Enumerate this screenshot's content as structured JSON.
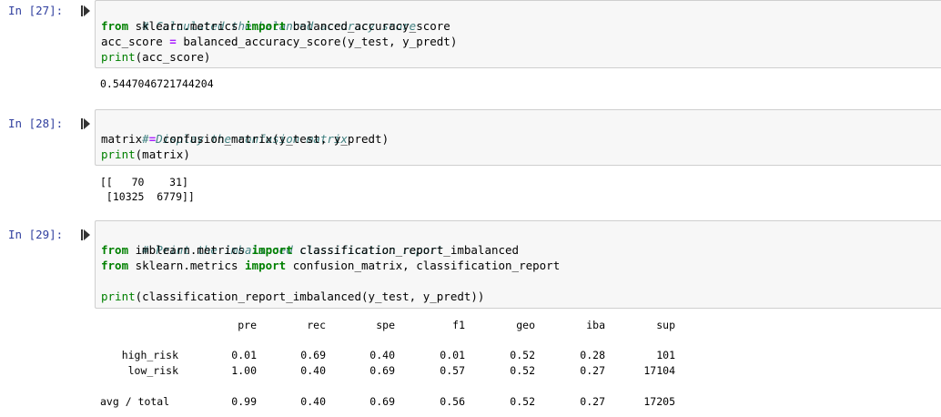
{
  "cells": [
    {
      "prompt": "In [27]:",
      "code": {
        "comment": "# Calculated the balanced accuracy score",
        "line2": {
          "kw1": "from",
          "mod": " sklearn.metrics ",
          "kw2": "import",
          "rest": " balanced_accuracy_score"
        },
        "line3": {
          "a": "acc_score ",
          "op": "=",
          "b": " balanced_accuracy_score(y_test, y_predt)"
        },
        "line4": {
          "fn": "print",
          "rest": "(acc_score)"
        }
      },
      "output": [
        "0.5447046721744204"
      ]
    },
    {
      "prompt": "In [28]:",
      "code": {
        "comment": "# Display the confusion matrix",
        "line2": {
          "a": "matrix ",
          "op": "=",
          "b": " confusion_matrix(y_test, y_predt)"
        },
        "line3": {
          "fn": "print",
          "rest": "(matrix)"
        }
      },
      "output": [
        "[[   70    31]",
        " [10325  6779]]"
      ]
    },
    {
      "prompt": "In [29]:",
      "code": {
        "comment": "# Print the imbalanced classification report",
        "line2": {
          "kw1": "from",
          "mod": " imblearn.metrics ",
          "kw2": "import",
          "rest": " classification_report_imbalanced"
        },
        "line3": {
          "kw1": "from",
          "mod": " sklearn.metrics ",
          "kw2": "import",
          "rest": " confusion_matrix, classification_report"
        },
        "line5": {
          "fn": "print",
          "rest": "(classification_report_imbalanced(y_test, y_predt))"
        }
      },
      "report": {
        "headers": [
          "pre",
          "rec",
          "spe",
          "f1",
          "geo",
          "iba",
          "sup"
        ],
        "rows": [
          {
            "label": "high_risk",
            "values": [
              "0.01",
              "0.69",
              "0.40",
              "0.01",
              "0.52",
              "0.28",
              "101"
            ]
          },
          {
            "label": "low_risk",
            "values": [
              "1.00",
              "0.40",
              "0.69",
              "0.57",
              "0.52",
              "0.27",
              "17104"
            ]
          },
          {
            "label": "avg / total",
            "values": [
              "0.99",
              "0.40",
              "0.69",
              "0.56",
              "0.52",
              "0.27",
              "17205"
            ]
          }
        ]
      }
    }
  ],
  "icons": {
    "run": "run-cell-icon"
  },
  "colors": {
    "prompt": "#303f9f",
    "comment": "#408080",
    "keyword": "#008000",
    "operator": "#aa22ff",
    "code_bg": "#f7f7f7"
  }
}
